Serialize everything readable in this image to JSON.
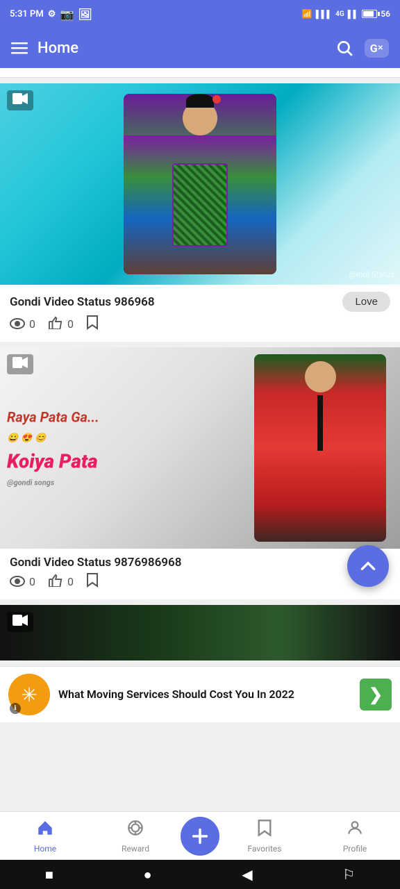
{
  "statusBar": {
    "time": "5:31 PM",
    "batteryPercent": "56"
  },
  "appBar": {
    "menuLabel": "☰",
    "title": "Home",
    "searchLabel": "🔍",
    "translateLabel": "G"
  },
  "cards": [
    {
      "id": "card1",
      "title": "Gondi Video Status 986968",
      "views": "0",
      "likes": "0",
      "loveBtnLabel": "Love",
      "watermark": "@indi Status"
    },
    {
      "id": "card2",
      "title": "Gondi Video Status 9876986968",
      "views": "0",
      "likes": "0",
      "textOverlay1": "Raya Pata Ga...",
      "textOverlay2": "Koiya Pata"
    }
  ],
  "ad": {
    "text": "What Moving Services Should Cost You In 2022",
    "arrowLabel": "❯"
  },
  "bottomNav": {
    "items": [
      {
        "id": "home",
        "label": "Home",
        "active": true
      },
      {
        "id": "reward",
        "label": "Reward",
        "active": false
      },
      {
        "id": "add",
        "label": "+",
        "active": false
      },
      {
        "id": "favorites",
        "label": "Favorites",
        "active": false
      },
      {
        "id": "profile",
        "label": "Profile",
        "active": false
      }
    ]
  },
  "androidNav": {
    "squareLabel": "■",
    "circleLabel": "●",
    "backLabel": "◀",
    "accessibilityLabel": "⚐"
  }
}
